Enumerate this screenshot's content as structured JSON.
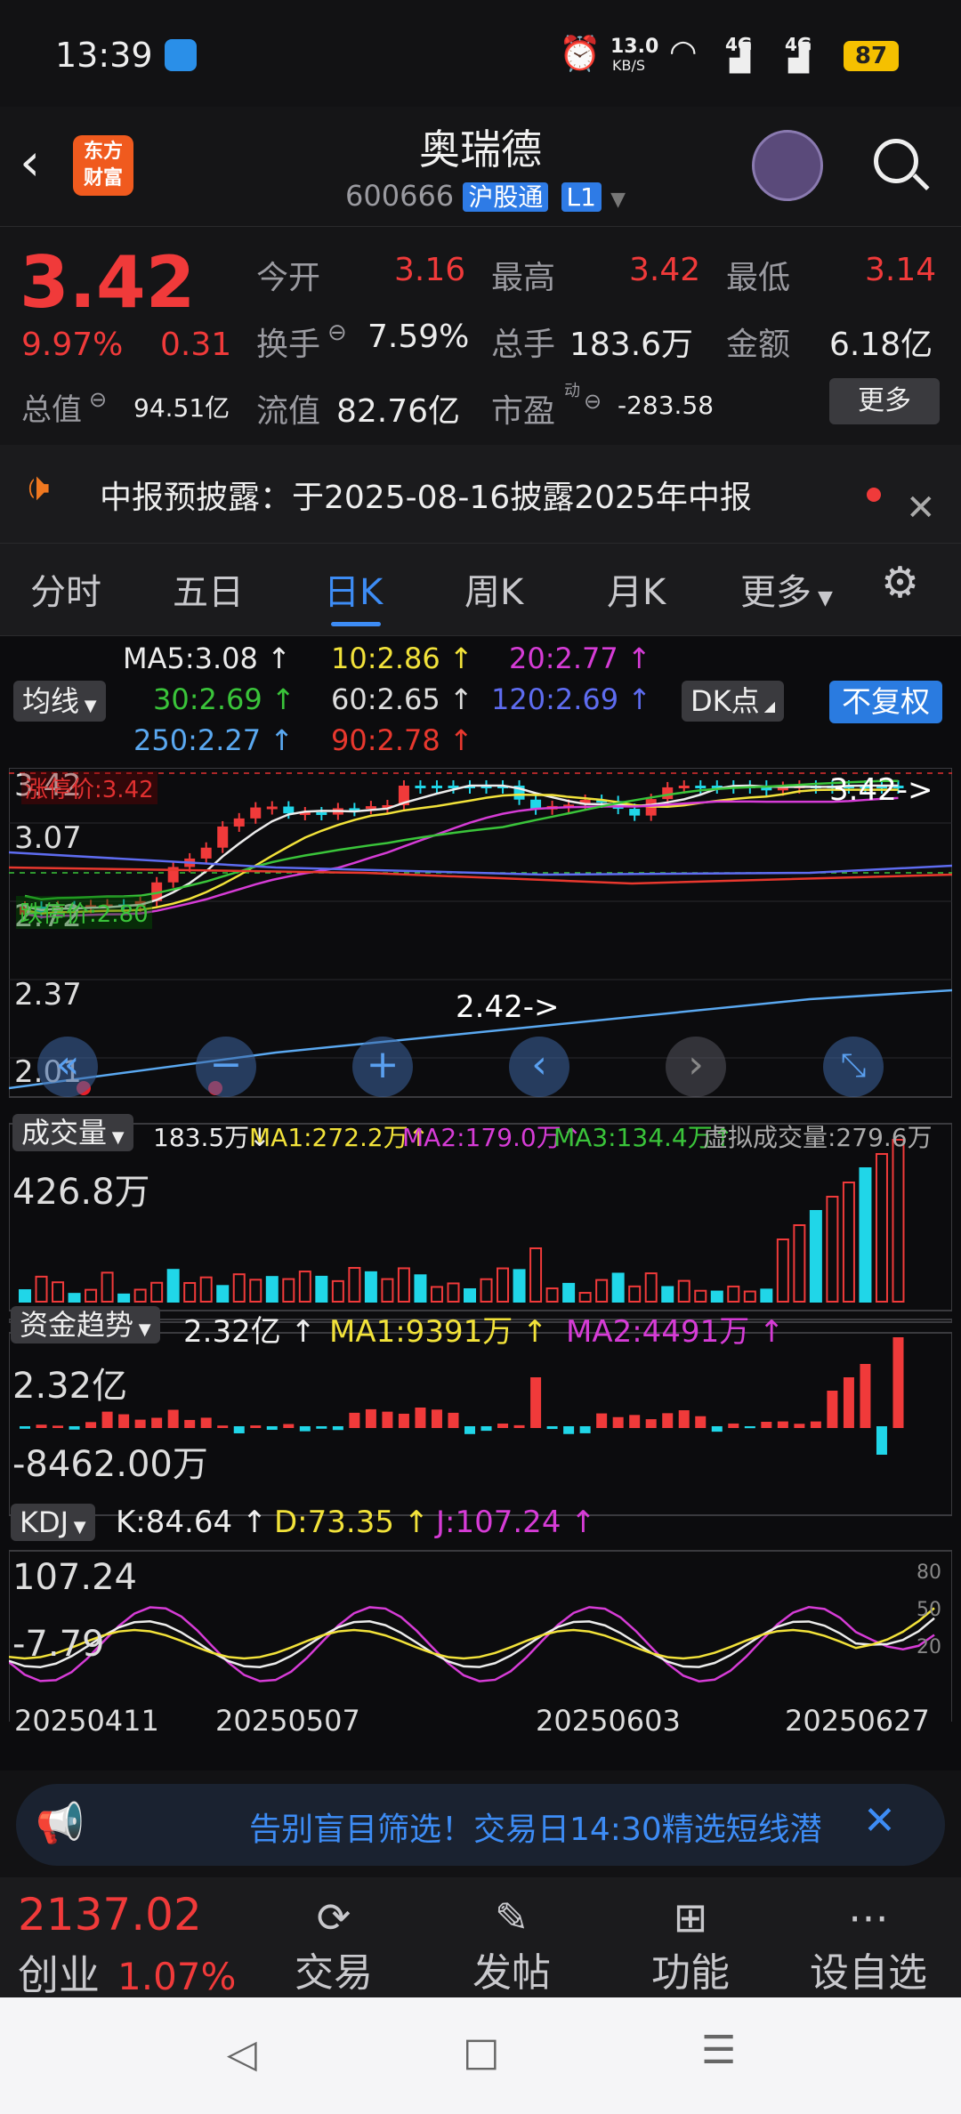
{
  "status_bar": {
    "time": "13:39",
    "net_speed_value": "13.0",
    "net_speed_unit": "KB/S",
    "net1": "4G",
    "net2": "4G",
    "battery": "87"
  },
  "header": {
    "title": "奥瑞德",
    "code": "600666",
    "market": "沪股通",
    "level": "L1",
    "logo_line1": "东方",
    "logo_line2": "财富"
  },
  "quote": {
    "price": "3.42",
    "change_pct": "9.97%",
    "change_amt": "0.31",
    "open_label": "今开",
    "open": "3.16",
    "high_label": "最高",
    "high": "3.42",
    "low_label": "最低",
    "low": "3.14",
    "turnover_label": "换手",
    "turnover": "7.59%",
    "volume_label": "总手",
    "volume": "183.6万",
    "amount_label": "金额",
    "amount": "6.18亿",
    "mcap_label": "总值",
    "mcap": "94.51亿",
    "float_label": "流值",
    "float": "82.76亿",
    "pe_label": "市盈",
    "pe_sup": "动",
    "pe": "-283.58",
    "more": "更多"
  },
  "notice": {
    "text": "中报预披露：于2025-08-16披露2025年中报"
  },
  "tabs": [
    "分时",
    "五日",
    "日K",
    "周K",
    "月K",
    "更多"
  ],
  "ma_panel": {
    "selector": "均线",
    "ma5": "MA5:3.08 ↑",
    "ma10": "10:2.86 ↑",
    "ma20": "20:2.77 ↑",
    "ma30": "30:2.69 ↑",
    "ma60": "60:2.65 ↑",
    "ma120": "120:2.69 ↑",
    "ma250": "250:2.27 ↑",
    "ma90": "90:2.78 ↑",
    "dk": "DK点",
    "fq": "不复权"
  },
  "kline": {
    "y_top": "3.42",
    "y_2": "3.07",
    "y_3": "2.72",
    "y_4": "2.37",
    "y_5": "2.01",
    "limit_up": "涨停价:3.42",
    "limit_down": "跌停价:2.80",
    "max_label": "3.42->",
    "min_label": "2.42->"
  },
  "volume_panel": {
    "selector": "成交量",
    "vol": "183.5万↓",
    "ma1": "MA1:272.2万↑",
    "ma2": "MA2:179.0万↑",
    "ma3": "MA3:134.4万↑",
    "virtual": "虚拟成交量:279.6万",
    "max": "426.8万"
  },
  "fund_panel": {
    "selector": "资金趋势",
    "val": "2.32亿 ↑",
    "ma1": "MA1:9391万 ↑",
    "ma2": "MA2:4491万 ↑",
    "top": "2.32亿",
    "bottom": "-8462.00万"
  },
  "kdj_panel": {
    "selector": "KDJ",
    "k": "K:84.64 ↑",
    "d": "D:73.35 ↑",
    "j": "J:107.24 ↑",
    "top": "107.24",
    "bottom": "-7.79",
    "l80": "80",
    "l50": "50",
    "l20": "20"
  },
  "dates": [
    "20250411",
    "20250507",
    "20250603",
    "20250627"
  ],
  "ad": {
    "text": "告别盲目筛选！交易日14:30精选短线潜"
  },
  "bottom_nav": {
    "index_value": "2137.02",
    "index_name": "创业",
    "index_pct": "1.07%",
    "trade": "交易",
    "post": "发帖",
    "func": "功能",
    "watch": "设自选"
  },
  "colors": {
    "up": "#f03a3a",
    "down": "#20d6e8",
    "accent": "#3d8cf5"
  }
}
